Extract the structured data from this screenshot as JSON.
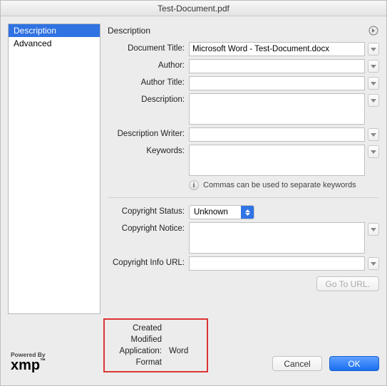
{
  "window": {
    "title": "Test-Document.pdf"
  },
  "sidebar": {
    "items": [
      {
        "label": "Description",
        "selected": true
      },
      {
        "label": "Advanced",
        "selected": false
      }
    ]
  },
  "main": {
    "heading": "Description",
    "fields": {
      "document_title": {
        "label": "Document Title:",
        "value": "Microsoft Word - Test-Document.docx"
      },
      "author": {
        "label": "Author:",
        "value": ""
      },
      "author_title": {
        "label": "Author Title:",
        "value": ""
      },
      "description": {
        "label": "Description:",
        "value": ""
      },
      "description_writer": {
        "label": "Description Writer:",
        "value": ""
      },
      "keywords": {
        "label": "Keywords:",
        "value": ""
      },
      "keywords_hint": "Commas can be used to separate keywords",
      "copyright_status": {
        "label": "Copyright Status:",
        "value": "Unknown"
      },
      "copyright_notice": {
        "label": "Copyright Notice:",
        "value": ""
      },
      "copyright_url": {
        "label": "Copyright Info URL:",
        "value": ""
      },
      "go_to_url": "Go To URL."
    }
  },
  "footer": {
    "powered_by": "Powered By",
    "logo": "xmp",
    "meta": {
      "created_label": "Created",
      "modified_label": "Modified",
      "application_label": "Application:",
      "application_value": "Word",
      "format_label": "Format"
    },
    "cancel": "Cancel",
    "ok": "OK"
  }
}
